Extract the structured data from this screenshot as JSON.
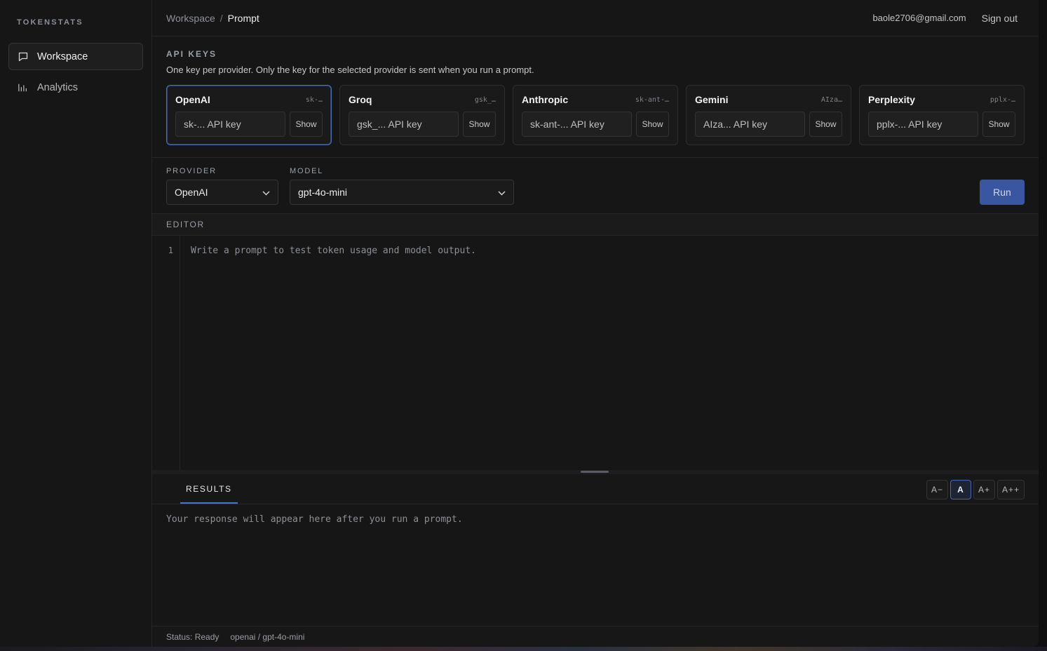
{
  "sidebar": {
    "brand": "TOKENSTATS",
    "items": [
      {
        "label": "Workspace",
        "icon": "chat-icon",
        "active": true
      },
      {
        "label": "Analytics",
        "icon": "bar-chart-icon",
        "active": false
      }
    ]
  },
  "header": {
    "breadcrumb_parent": "Workspace",
    "breadcrumb_sep": "/",
    "breadcrumb_current": "Prompt",
    "user_email": "baole2706@gmail.com",
    "sign_out": "Sign out"
  },
  "api_keys": {
    "title": "API KEYS",
    "description": "One key per provider. Only the key for the selected provider is sent when you run a prompt.",
    "providers": [
      {
        "name": "OpenAI",
        "prefix": "sk-…",
        "placeholder": "sk-... API key",
        "show": "Show",
        "selected": true
      },
      {
        "name": "Groq",
        "prefix": "gsk_…",
        "placeholder": "gsk_... API key",
        "show": "Show",
        "selected": false
      },
      {
        "name": "Anthropic",
        "prefix": "sk-ant-…",
        "placeholder": "sk-ant-... API key",
        "show": "Show",
        "selected": false
      },
      {
        "name": "Gemini",
        "prefix": "AIza…",
        "placeholder": "AIza... API key",
        "show": "Show",
        "selected": false
      },
      {
        "name": "Perplexity",
        "prefix": "pplx-…",
        "placeholder": "pplx-... API key",
        "show": "Show",
        "selected": false
      }
    ]
  },
  "controls": {
    "provider_label": "PROVIDER",
    "provider_value": "OpenAI",
    "model_label": "MODEL",
    "model_value": "gpt-4o-mini",
    "run": "Run",
    "accent": "#3a56a0"
  },
  "editor": {
    "header": "EDITOR",
    "line_number": "1",
    "placeholder": "Write a prompt to test token usage and model output."
  },
  "results": {
    "tab": "RESULTS",
    "font_sizes": [
      "A−",
      "A",
      "A+",
      "A++"
    ],
    "active_font": "A",
    "placeholder": "Your response will appear here after you run a prompt."
  },
  "status": {
    "state": "Status: Ready",
    "model": "openai / gpt-4o-mini"
  }
}
